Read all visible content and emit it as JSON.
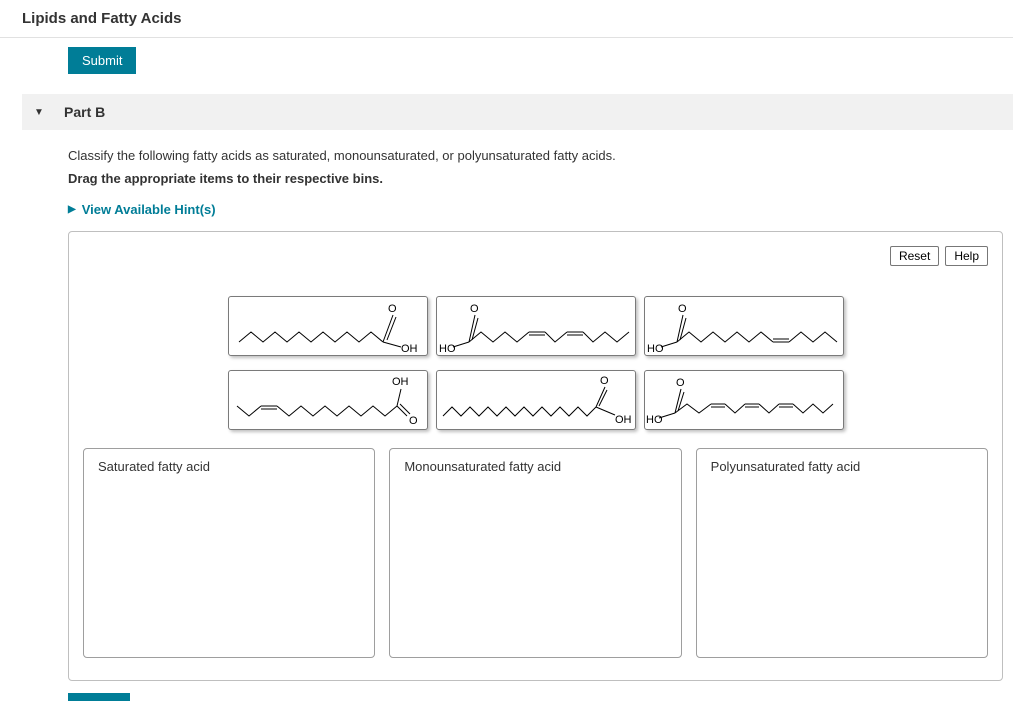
{
  "title": "Lipids and Fatty Acids",
  "submit_label": "Submit",
  "part": {
    "label": "Part B",
    "prompt": "Classify the following fatty acids as saturated, monounsaturated, or polyunsaturated fatty acids.",
    "instruction": "Drag the appropriate items to their respective bins."
  },
  "hints_label": "View Available Hint(s)",
  "buttons": {
    "reset": "Reset",
    "help": "Help"
  },
  "bins": [
    {
      "label": "Saturated fatty acid"
    },
    {
      "label": "Monounsaturated fatty acid"
    },
    {
      "label": "Polyunsaturated fatty acid"
    }
  ],
  "items": [
    {
      "id": "item1",
      "desc": "straight chain with COOH on right",
      "labels": [
        "O",
        "OH"
      ]
    },
    {
      "id": "item2",
      "desc": "chain with two cis double bonds, COOH left",
      "labels": [
        "O",
        "HO"
      ]
    },
    {
      "id": "item3",
      "desc": "chain with one cis double bond, COOH left",
      "labels": [
        "O",
        "HO"
      ]
    },
    {
      "id": "item4",
      "desc": "chain with one cis double bond near left end, COOH on right",
      "labels": [
        "OH",
        "O"
      ]
    },
    {
      "id": "item5",
      "desc": "long straight chain, COOH right end",
      "labels": [
        "O",
        "OH"
      ]
    },
    {
      "id": "item6",
      "desc": "chain with multiple double bonds, COOH left",
      "labels": [
        "O",
        "HO"
      ]
    }
  ]
}
